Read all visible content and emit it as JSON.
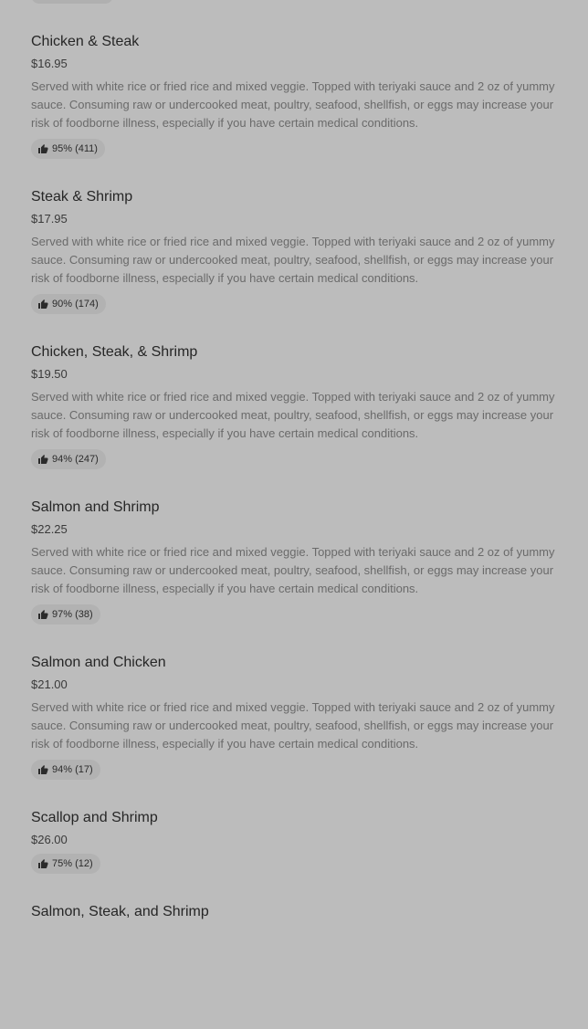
{
  "menu": {
    "items": [
      {
        "name": "Chicken & Steak",
        "price": "$16.95",
        "description": "Served with white rice or fried rice and mixed veggie. Topped with teriyaki sauce and 2 oz of yummy sauce. Consuming raw or undercooked meat, poultry, seafood, shellfish, or eggs may increase your risk of foodborne illness, especially if you have certain medical conditions.",
        "rating": "95% (411)"
      },
      {
        "name": "Steak & Shrimp",
        "price": "$17.95",
        "description": "Served with white rice or fried rice and mixed veggie. Topped with teriyaki sauce and 2 oz of yummy sauce. Consuming raw or undercooked meat, poultry, seafood, shellfish, or eggs may increase your risk of foodborne illness, especially if you have certain medical conditions.",
        "rating": "90% (174)"
      },
      {
        "name": "Chicken, Steak, & Shrimp",
        "price": "$19.50",
        "description": "Served with white rice or fried rice and mixed veggie. Topped with teriyaki sauce and 2 oz of yummy sauce. Consuming raw or undercooked meat, poultry, seafood, shellfish, or eggs may increase your risk of foodborne illness, especially if you have certain medical conditions.",
        "rating": "94% (247)"
      },
      {
        "name": "Salmon and Shrimp",
        "price": "$22.25",
        "description": "Served with white rice or fried rice and mixed veggie. Topped with teriyaki sauce and 2 oz of yummy sauce. Consuming raw or undercooked meat, poultry, seafood, shellfish, or eggs may increase your risk of foodborne illness, especially if you have certain medical conditions.",
        "rating": "97% (38)"
      },
      {
        "name": "Salmon and Chicken",
        "price": "$21.00",
        "description": "Served with white rice or fried rice and mixed veggie. Topped with teriyaki sauce and 2 oz of yummy sauce. Consuming raw or undercooked meat, poultry, seafood, shellfish, or eggs may increase your risk of foodborne illness, especially if you have certain medical conditions.",
        "rating": "94% (17)"
      },
      {
        "name": "Scallop and Shrimp",
        "price": "$26.00",
        "description": "",
        "rating": "75% (12)"
      },
      {
        "name": "Salmon, Steak, and Shrimp",
        "price": "",
        "description": "",
        "rating": ""
      }
    ]
  },
  "icons": {
    "rating": "thumbs-up-icon"
  }
}
